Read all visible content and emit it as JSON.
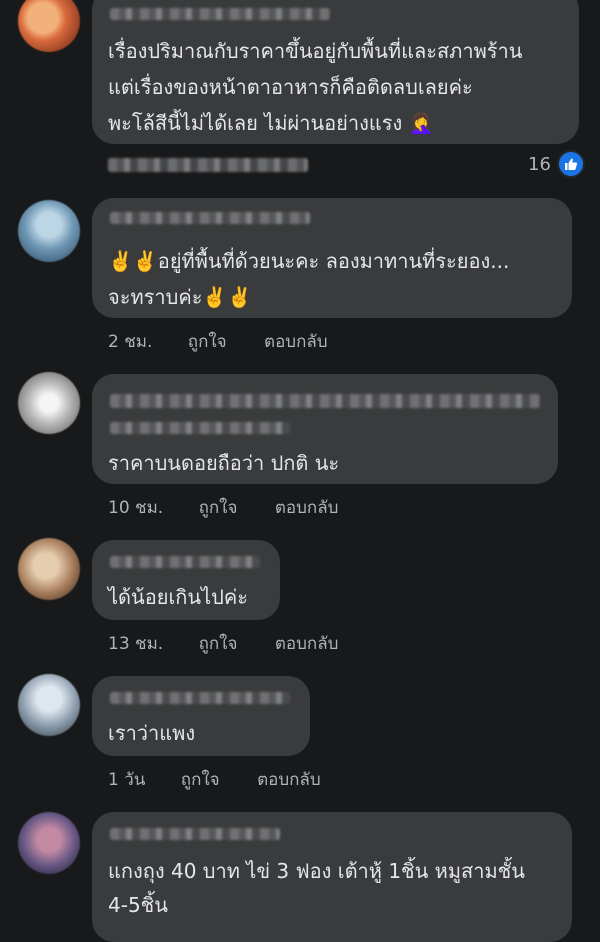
{
  "colors": {
    "background": "#18191a",
    "bubble": "#3a3b3c",
    "text": "#e4e6eb",
    "meta": "#b0b3b8",
    "like_blue": "#1b74e4"
  },
  "comments": [
    {
      "lines": [
        "เรื่องปริมาณกับราคาขึ้นอยู่กับพื้นที่และสภาพร้าน",
        "แต่เรื่องของหน้าตาอาหารก็คือติดลบเลยค่ะ",
        "พะโล้สีนี้ไม่ได้เลย ไม่ผ่านอย่างแรง 🤦‍♀️"
      ],
      "reaction_count": "16",
      "reaction_icon": "like-icon"
    },
    {
      "lines": [
        "✌️✌️อยู่ที่พื้นที่ด้วยนะคะ ลองมาทานที่ระยอง...",
        "จะทราบค่ะ✌️✌️"
      ],
      "time": "2 ชม.",
      "like": "ถูกใจ",
      "reply": "ตอบกลับ"
    },
    {
      "lines": [
        "ราคาบนดอยถือว่า ปกติ  นะ"
      ],
      "time": "10 ชม.",
      "like": "ถูกใจ",
      "reply": "ตอบกลับ"
    },
    {
      "lines": [
        "ได้น้อยเกินไปค่ะ"
      ],
      "time": "13 ชม.",
      "like": "ถูกใจ",
      "reply": "ตอบกลับ"
    },
    {
      "lines": [
        "เราว่าแพง"
      ],
      "time": "1 วัน",
      "like": "ถูกใจ",
      "reply": "ตอบกลับ"
    },
    {
      "lines": [
        "แกงถุง 40 บาท ไข่ 3 ฟอง เต้าหู้ 1ชิ้น หมูสามชั้น",
        "4-5ชิ้น"
      ]
    }
  ]
}
